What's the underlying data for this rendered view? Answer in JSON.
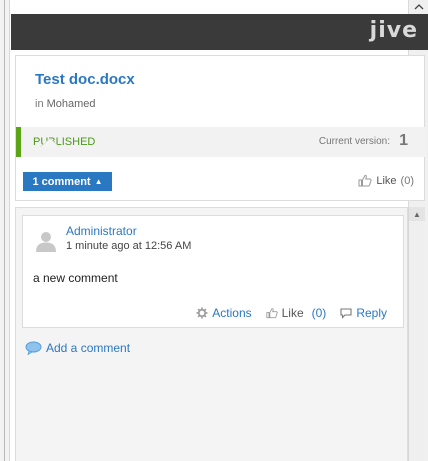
{
  "header": {
    "logo_text": "jive"
  },
  "document": {
    "title": "Test doc.docx",
    "location_prefix": "in",
    "location": "Mohamed",
    "status": "PUBLISHED",
    "version_label": "Current version:",
    "version_number": "1",
    "comment_toggle_label": "1 comment",
    "comment_toggle_arrow": "▲",
    "like_label": "Like",
    "like_count": "(0)"
  },
  "comments": [
    {
      "author": "Administrator",
      "timestamp": "1 minute ago at 12:56 AM",
      "body": "a new comment",
      "actions_label": "Actions",
      "like_label": "Like",
      "like_count": "(0)",
      "reply_label": "Reply"
    }
  ],
  "add_comment_label": "Add a comment",
  "colors": {
    "accent": "#2b78c2",
    "published": "#4a9a16",
    "header_bg": "#3a3a3a"
  },
  "icons": {
    "scroll_up": "chevron-up-icon",
    "avatar": "default-avatar-icon",
    "actions": "gear-icon",
    "like": "thumbs-up-icon",
    "reply": "speech-bubble-icon",
    "add_comment": "speech-bubble-icon"
  }
}
